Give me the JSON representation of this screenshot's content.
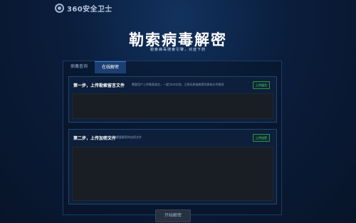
{
  "app": {
    "logo_text": "360安全卫士"
  },
  "hero": {
    "title": "勒索病毒解密",
    "subtitle": "勒索病毒搜索引擎，对症下药"
  },
  "tabs": [
    {
      "label": "病毒查询",
      "active": false
    },
    {
      "label": "在线解密",
      "active": true
    }
  ],
  "step1": {
    "title": "第一步，上传勒索留言文件",
    "description": "需要用户上传勒索留言，一般为txt文档，立即还原被勒索的原始文件路径",
    "upload_label": "上传留言"
  },
  "step2": {
    "title": "第二步，上传加密文件",
    "description": "用户上传需要解密的加密文件",
    "upload_label": "上传加密"
  },
  "actions": {
    "start_label": "开始解密"
  },
  "colors": {
    "background": "#0a1d3b",
    "active_tab": "#1b3f72",
    "upload_green": "#4fd87a",
    "dropzone": "#191e25"
  }
}
